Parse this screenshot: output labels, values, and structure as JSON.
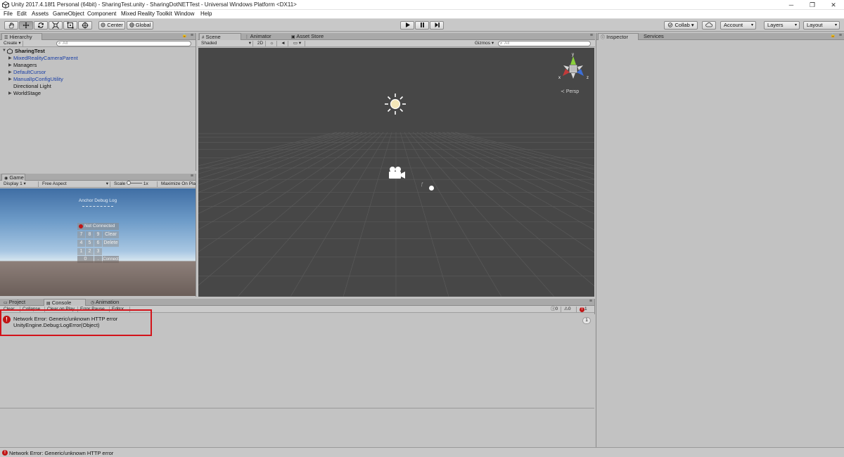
{
  "window": {
    "title": "Unity 2017.4.18f1 Personal (64bit) - SharingTest.unity - SharingDotNETTest - Universal Windows Platform <DX11>",
    "minimize": "─",
    "restore": "❐",
    "close": "✕"
  },
  "menu": [
    "File",
    "Edit",
    "Assets",
    "GameObject",
    "Component",
    "Mixed Reality Toolkit",
    "Window",
    "Help"
  ],
  "toolbar": {
    "pivot": "Center",
    "space": "Global",
    "collab": "Collab ▾",
    "account": "Account",
    "layers": "Layers",
    "layout": "Layout"
  },
  "hierarchy": {
    "tab": "Hierarchy",
    "create": "Create",
    "search_placeholder": "All",
    "scene": "SharingTest",
    "items": [
      {
        "label": "MixedRealityCameraParent",
        "blue": true,
        "expandable": true
      },
      {
        "label": "Managers",
        "blue": false,
        "expandable": true
      },
      {
        "label": "DefaultCursor",
        "blue": true,
        "expandable": true
      },
      {
        "label": "ManualIpConfigUtility",
        "blue": true,
        "expandable": true
      },
      {
        "label": "Directional Light",
        "blue": false,
        "expandable": false
      },
      {
        "label": "WorldStage",
        "blue": false,
        "expandable": true
      }
    ]
  },
  "scene": {
    "tabs": [
      "Scene",
      "Animator",
      "Asset Store"
    ],
    "shading": "Shaded",
    "mode2d": "2D",
    "gizmos": "Gizmos",
    "search_placeholder": "All",
    "persp": "Persp"
  },
  "inspector": {
    "tabs": [
      "Inspector",
      "Services"
    ]
  },
  "game": {
    "tab": "Game",
    "display": "Display 1",
    "aspect": "Free Aspect",
    "scale_label": "Scale",
    "scale_value": "1x",
    "maximize": "Maximize On Pla",
    "anchor_title": "Anchor Debug Log",
    "status": "Not Connected",
    "keypad": [
      [
        "7",
        "8",
        "9"
      ],
      [
        "4",
        "5",
        "6"
      ],
      [
        "1",
        "2",
        "3"
      ]
    ],
    "zero": "0",
    "dot": ".",
    "clear": "Clear",
    "delete": "Delete",
    "connect": "Connect"
  },
  "bottom_tabs": [
    "Project",
    "Console",
    "Animation"
  ],
  "console": {
    "buttons": [
      "Clear",
      "Collapse",
      "Clear on Play",
      "Error Pause",
      "Editor"
    ],
    "count_info": "0",
    "count_warn": "0",
    "count_error": "1",
    "entry_line1": "Network Error: Generic/unknown HTTP error",
    "entry_line2": "UnityEngine.Debug:LogError(Object)",
    "entry_count": "1"
  },
  "status": {
    "message": "Network Error: Generic/unknown HTTP error"
  },
  "colors": {
    "error": "#c01515",
    "highlight_box": "#d3131a",
    "scene_bg": "#474747"
  }
}
